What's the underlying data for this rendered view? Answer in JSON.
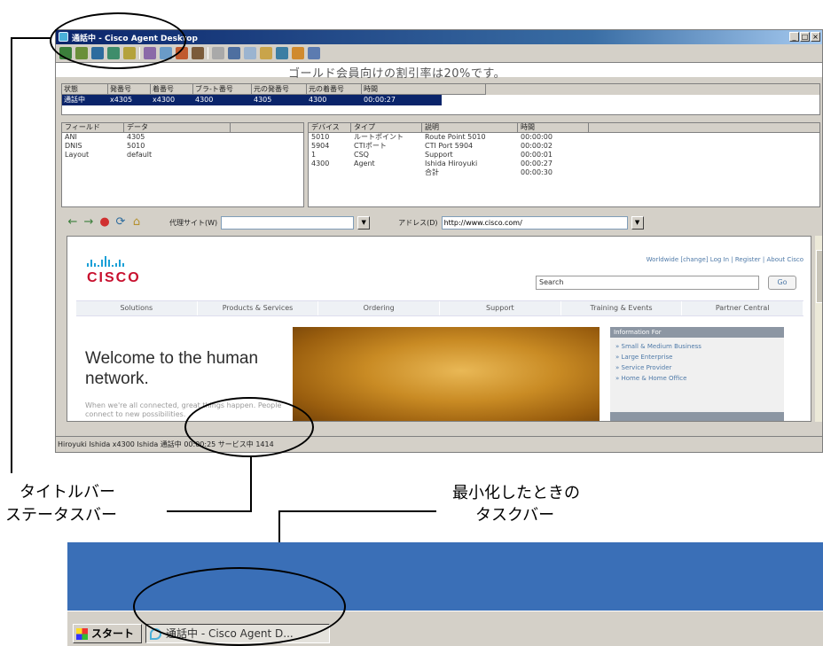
{
  "window": {
    "title": "通話中 - Cisco Agent Desktop",
    "controls": [
      "_",
      "□",
      "×"
    ],
    "announcement": "ゴールド会員向けの割引率は20%です。"
  },
  "call_grid": {
    "headers": [
      "状態",
      "発番号",
      "着番号",
      "ブラ-ト番号",
      "元の発番号",
      "元の着番号",
      "時間"
    ],
    "row": [
      "通話中",
      "x4305",
      "x4300",
      "4300",
      "4305",
      "4300",
      "00:00:27"
    ]
  },
  "info_left": {
    "headers": [
      "フィールド",
      "データ"
    ],
    "rows": [
      [
        "ANI",
        "4305"
      ],
      [
        "DNIS",
        "5010"
      ],
      [
        "Layout",
        "default"
      ]
    ]
  },
  "info_right": {
    "headers": [
      "デバイス",
      "タイプ",
      "説明",
      "時間"
    ],
    "rows": [
      [
        "5010",
        "ルートポイント",
        "Route Point 5010",
        "00:00:00"
      ],
      [
        "5904",
        "CTIポート",
        "CTI Port 5904",
        "00:00:02"
      ],
      [
        "1",
        "CSQ",
        "Support",
        "00:00:01"
      ],
      [
        "4300",
        "Agent",
        "Ishida Hiroyuki",
        "00:00:27"
      ],
      [
        "",
        "",
        "合計",
        "00:00:30"
      ]
    ]
  },
  "browser": {
    "sites_label": "代理サイト(W)",
    "address_label": "アドレス(D)",
    "address_value": "http://www.cisco.com/",
    "web": {
      "logo": "CISCO",
      "top_links": "Worldwide [change]    Log In  |  Register  |  About Cisco",
      "search_placeholder": "Search",
      "go_label": "Go",
      "menu": [
        "Solutions",
        "Products & Services",
        "Ordering",
        "Support",
        "Training & Events",
        "Partner Central"
      ],
      "welcome": "Welcome to the human network.",
      "welcome_sub": "When we're all connected, great things happen. People connect to new possibilities.",
      "side_header": "Information For",
      "side_links": [
        "» Small & Medium Business",
        "» Large Enterprise",
        "» Service Provider",
        "» Home & Home Office"
      ]
    }
  },
  "status_bar": {
    "text": "Hiroyuki Ishida  x4300  Ishida  通話中  00:00:25  サービス中  1414"
  },
  "callouts": {
    "title_status": "タイトルバー\nステータスバー",
    "title_line1": "タイトルバー",
    "title_line2": "ステータスバー",
    "taskbar_line1": "最小化したときの",
    "taskbar_line2": "タスクバー"
  },
  "taskbar": {
    "start_label": "スタート",
    "task_label": "通話中 - Cisco Agent D..."
  },
  "colors": {
    "titlebar": "#0a246a",
    "desktop": "#3a6fb7",
    "selection": "#0a246a",
    "cisco_red": "#c8102e",
    "cisco_blue": "#1ba0d7"
  }
}
